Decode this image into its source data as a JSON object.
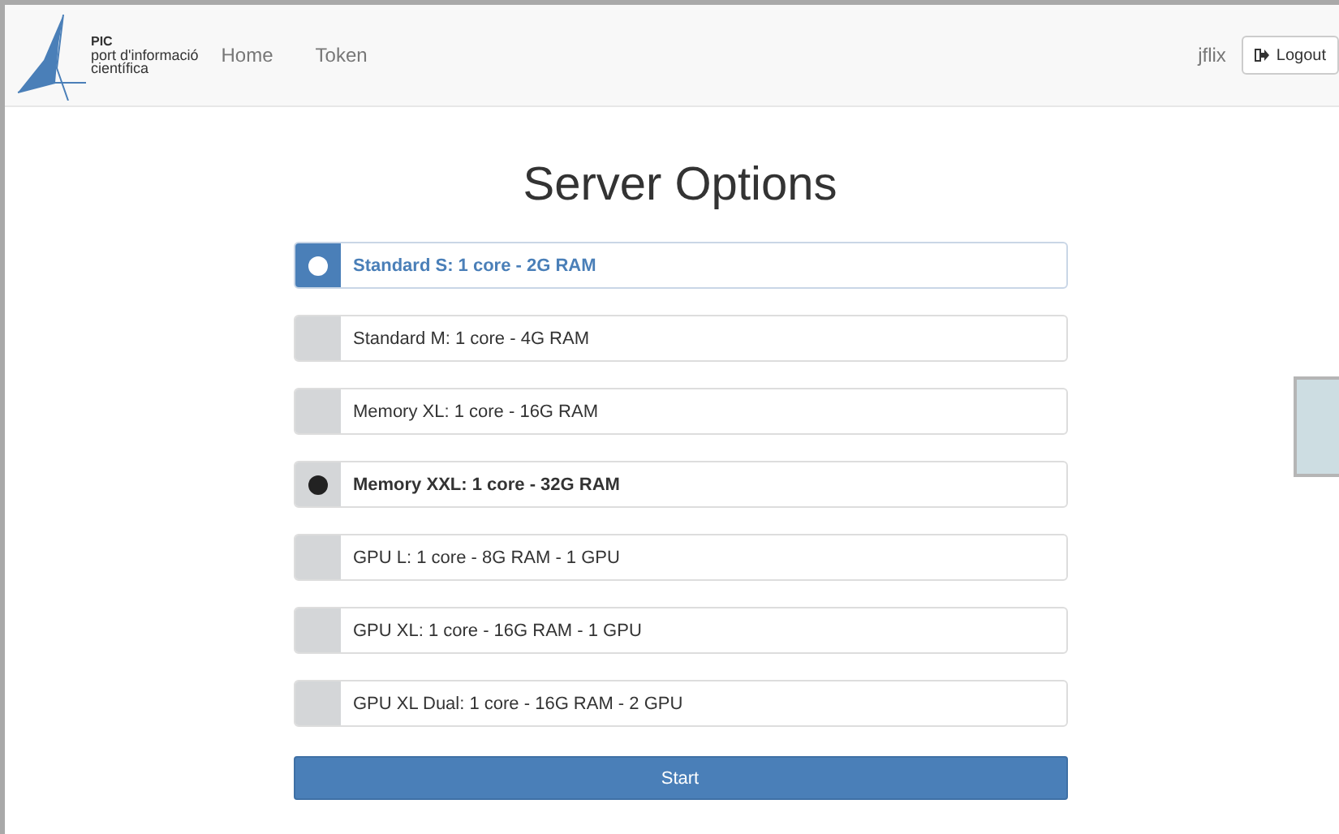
{
  "brand": {
    "abbr": "PIC",
    "line1": "port d'informació",
    "line2": "científica"
  },
  "nav": [
    {
      "label": "Home"
    },
    {
      "label": "Token"
    }
  ],
  "user": "jflix",
  "logout": {
    "label": "Logout"
  },
  "title": "Server Options",
  "options": [
    {
      "label": "Standard S: 1 core - 2G RAM",
      "selected": true,
      "hovered": false
    },
    {
      "label": "Standard M: 1 core - 4G RAM",
      "selected": false,
      "hovered": false
    },
    {
      "label": "Memory XL: 1 core - 16G RAM",
      "selected": false,
      "hovered": false
    },
    {
      "label": "Memory XXL: 1 core - 32G RAM",
      "selected": false,
      "hovered": true
    },
    {
      "label": "GPU L: 1 core - 8G RAM - 1 GPU",
      "selected": false,
      "hovered": false
    },
    {
      "label": "GPU XL: 1 core - 16G RAM - 1 GPU",
      "selected": false,
      "hovered": false
    },
    {
      "label": "GPU XL Dual: 1 core - 16G RAM - 2 GPU",
      "selected": false,
      "hovered": false
    }
  ],
  "start": {
    "label": "Start"
  }
}
